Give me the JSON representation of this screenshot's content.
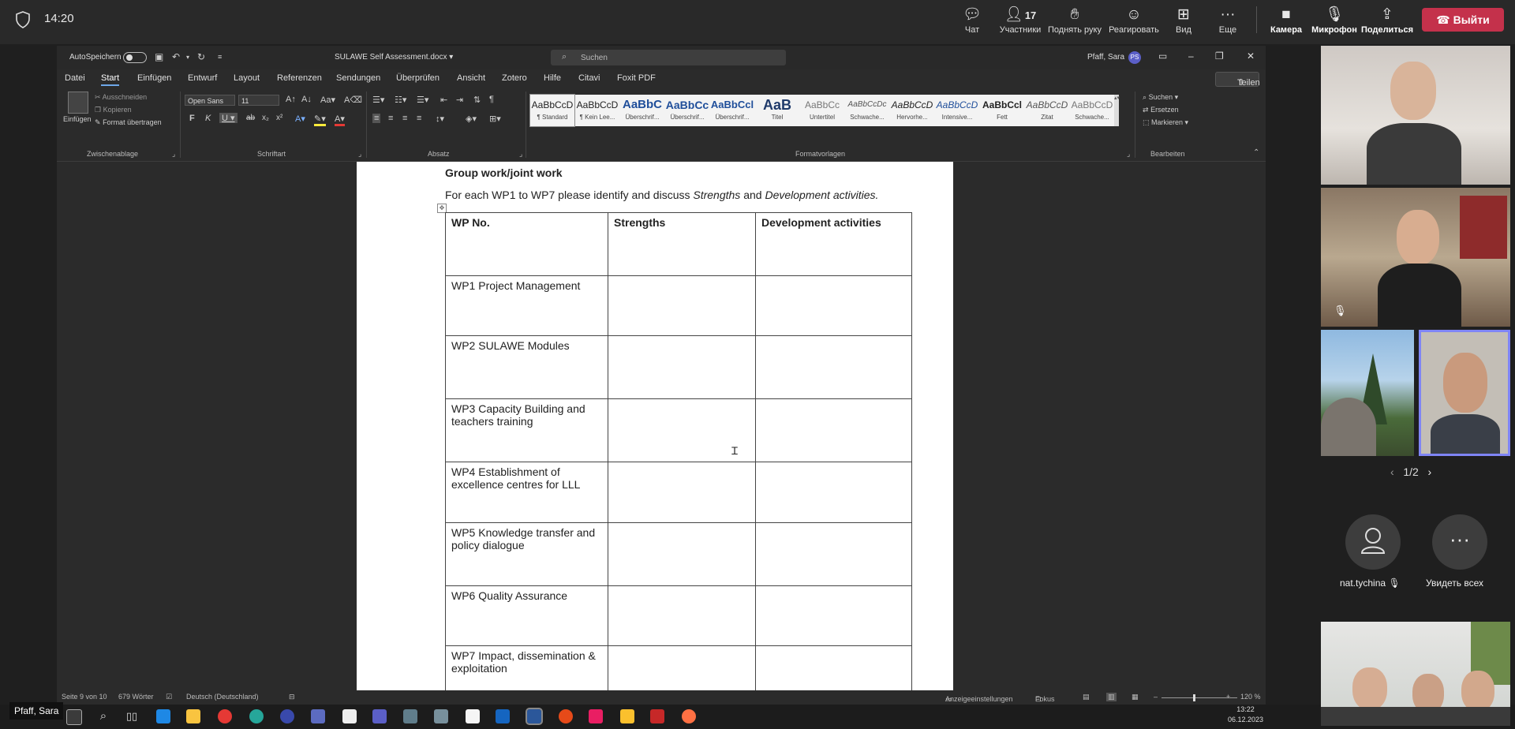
{
  "meeting": {
    "time": "14:20",
    "buttons": {
      "chat": "Чат",
      "participants": "Участники",
      "participants_count": "17",
      "raise_hand": "Поднять руку",
      "react": "Реагировать",
      "view": "Вид",
      "more": "Еще",
      "camera": "Камера",
      "mic": "Микрофон",
      "share": "Поделиться",
      "leave": "Выйти"
    },
    "name_badge": "Pfaff, Sara",
    "pager": "1/2",
    "participant_name": "nat.tychina",
    "see_all": "Увидеть всех"
  },
  "word": {
    "autosave": "AutoSpeichern",
    "doc_title": "SULAWE Self Assessment.docx",
    "search_placeholder": "Suchen",
    "user": "Pfaff, Sara",
    "user_initials": "PS",
    "menu": [
      "Datei",
      "Start",
      "Einfügen",
      "Entwurf",
      "Layout",
      "Referenzen",
      "Sendungen",
      "Überprüfen",
      "Ansicht",
      "Zotero",
      "Hilfe",
      "Citavi",
      "Foxit PDF"
    ],
    "share": "Teilen",
    "clipboard": {
      "paste": "Einfügen",
      "cut": "Ausschneiden",
      "copy": "Kopieren",
      "format": "Format übertragen",
      "label": "Zwischenablage"
    },
    "font": {
      "name": "Open Sans",
      "size": "11",
      "label": "Schriftart"
    },
    "paragraph_label": "Absatz",
    "styles_label": "Formatvorlagen",
    "styles": [
      {
        "preview": "AaBbCcD",
        "name": "¶ Standard"
      },
      {
        "preview": "AaBbCcD",
        "name": "¶ Kein Lee..."
      },
      {
        "preview": "AaBbC",
        "name": "Überschrif..."
      },
      {
        "preview": "AaBbCc",
        "name": "Überschrif..."
      },
      {
        "preview": "AaBbCcl",
        "name": "Überschrif..."
      },
      {
        "preview": "AaB",
        "name": "Titel"
      },
      {
        "preview": "AaBbCc",
        "name": "Untertitel"
      },
      {
        "preview": "AaBbCcDc",
        "name": "Schwache..."
      },
      {
        "preview": "AaBbCcD",
        "name": "Hervorhe..."
      },
      {
        "preview": "AaBbCcD",
        "name": "Intensive..."
      },
      {
        "preview": "AaBbCcl",
        "name": "Fett"
      },
      {
        "preview": "AaBbCcD",
        "name": "Zitat"
      },
      {
        "preview": "AaBbCcD",
        "name": "Schwache..."
      }
    ],
    "edit": {
      "find": "Suchen",
      "replace": "Ersetzen",
      "select": "Markieren",
      "label": "Bearbeiten"
    },
    "status": {
      "page": "Seite 9 von 10",
      "words": "679 Wörter",
      "language": "Deutsch (Deutschland)",
      "display": "Anzeigeeinstellungen",
      "focus": "Fokus",
      "zoom": "120 %"
    }
  },
  "document": {
    "heading": "Group work/joint work",
    "intro_pre": "For each WP1 to WP7 please identify and discuss ",
    "intro_em1": "Strengths",
    "intro_mid": " and ",
    "intro_em2": "Development activities.",
    "table": {
      "headers": [
        "WP No.",
        "Strengths",
        "Development activities"
      ],
      "rows": [
        "WP1 Project Management",
        "WP2 SULAWE Modules",
        "WP3 Capacity Building and teachers training",
        "WP4 Establishment of excellence centres for LLL",
        "WP5 Knowledge transfer and policy dialogue",
        "WP6 Quality Assurance",
        "WP7 Impact, dissemination & exploitation"
      ]
    }
  },
  "taskbar": {
    "time": "13:22",
    "date": "06.12.2023"
  }
}
